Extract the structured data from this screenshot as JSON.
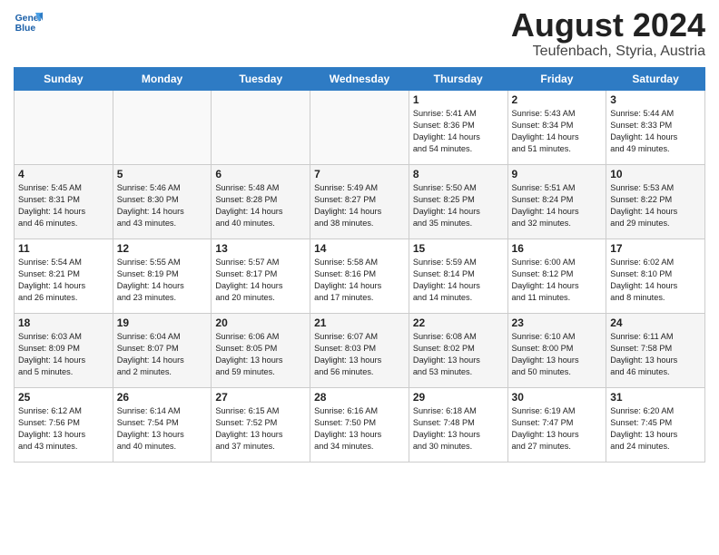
{
  "header": {
    "logo_line1": "General",
    "logo_line2": "Blue",
    "month_title": "August 2024",
    "subtitle": "Teufenbach, Styria, Austria"
  },
  "weekdays": [
    "Sunday",
    "Monday",
    "Tuesday",
    "Wednesday",
    "Thursday",
    "Friday",
    "Saturday"
  ],
  "weeks": [
    [
      {
        "day": "",
        "info": ""
      },
      {
        "day": "",
        "info": ""
      },
      {
        "day": "",
        "info": ""
      },
      {
        "day": "",
        "info": ""
      },
      {
        "day": "1",
        "info": "Sunrise: 5:41 AM\nSunset: 8:36 PM\nDaylight: 14 hours\nand 54 minutes."
      },
      {
        "day": "2",
        "info": "Sunrise: 5:43 AM\nSunset: 8:34 PM\nDaylight: 14 hours\nand 51 minutes."
      },
      {
        "day": "3",
        "info": "Sunrise: 5:44 AM\nSunset: 8:33 PM\nDaylight: 14 hours\nand 49 minutes."
      }
    ],
    [
      {
        "day": "4",
        "info": "Sunrise: 5:45 AM\nSunset: 8:31 PM\nDaylight: 14 hours\nand 46 minutes."
      },
      {
        "day": "5",
        "info": "Sunrise: 5:46 AM\nSunset: 8:30 PM\nDaylight: 14 hours\nand 43 minutes."
      },
      {
        "day": "6",
        "info": "Sunrise: 5:48 AM\nSunset: 8:28 PM\nDaylight: 14 hours\nand 40 minutes."
      },
      {
        "day": "7",
        "info": "Sunrise: 5:49 AM\nSunset: 8:27 PM\nDaylight: 14 hours\nand 38 minutes."
      },
      {
        "day": "8",
        "info": "Sunrise: 5:50 AM\nSunset: 8:25 PM\nDaylight: 14 hours\nand 35 minutes."
      },
      {
        "day": "9",
        "info": "Sunrise: 5:51 AM\nSunset: 8:24 PM\nDaylight: 14 hours\nand 32 minutes."
      },
      {
        "day": "10",
        "info": "Sunrise: 5:53 AM\nSunset: 8:22 PM\nDaylight: 14 hours\nand 29 minutes."
      }
    ],
    [
      {
        "day": "11",
        "info": "Sunrise: 5:54 AM\nSunset: 8:21 PM\nDaylight: 14 hours\nand 26 minutes."
      },
      {
        "day": "12",
        "info": "Sunrise: 5:55 AM\nSunset: 8:19 PM\nDaylight: 14 hours\nand 23 minutes."
      },
      {
        "day": "13",
        "info": "Sunrise: 5:57 AM\nSunset: 8:17 PM\nDaylight: 14 hours\nand 20 minutes."
      },
      {
        "day": "14",
        "info": "Sunrise: 5:58 AM\nSunset: 8:16 PM\nDaylight: 14 hours\nand 17 minutes."
      },
      {
        "day": "15",
        "info": "Sunrise: 5:59 AM\nSunset: 8:14 PM\nDaylight: 14 hours\nand 14 minutes."
      },
      {
        "day": "16",
        "info": "Sunrise: 6:00 AM\nSunset: 8:12 PM\nDaylight: 14 hours\nand 11 minutes."
      },
      {
        "day": "17",
        "info": "Sunrise: 6:02 AM\nSunset: 8:10 PM\nDaylight: 14 hours\nand 8 minutes."
      }
    ],
    [
      {
        "day": "18",
        "info": "Sunrise: 6:03 AM\nSunset: 8:09 PM\nDaylight: 14 hours\nand 5 minutes."
      },
      {
        "day": "19",
        "info": "Sunrise: 6:04 AM\nSunset: 8:07 PM\nDaylight: 14 hours\nand 2 minutes."
      },
      {
        "day": "20",
        "info": "Sunrise: 6:06 AM\nSunset: 8:05 PM\nDaylight: 13 hours\nand 59 minutes."
      },
      {
        "day": "21",
        "info": "Sunrise: 6:07 AM\nSunset: 8:03 PM\nDaylight: 13 hours\nand 56 minutes."
      },
      {
        "day": "22",
        "info": "Sunrise: 6:08 AM\nSunset: 8:02 PM\nDaylight: 13 hours\nand 53 minutes."
      },
      {
        "day": "23",
        "info": "Sunrise: 6:10 AM\nSunset: 8:00 PM\nDaylight: 13 hours\nand 50 minutes."
      },
      {
        "day": "24",
        "info": "Sunrise: 6:11 AM\nSunset: 7:58 PM\nDaylight: 13 hours\nand 46 minutes."
      }
    ],
    [
      {
        "day": "25",
        "info": "Sunrise: 6:12 AM\nSunset: 7:56 PM\nDaylight: 13 hours\nand 43 minutes."
      },
      {
        "day": "26",
        "info": "Sunrise: 6:14 AM\nSunset: 7:54 PM\nDaylight: 13 hours\nand 40 minutes."
      },
      {
        "day": "27",
        "info": "Sunrise: 6:15 AM\nSunset: 7:52 PM\nDaylight: 13 hours\nand 37 minutes."
      },
      {
        "day": "28",
        "info": "Sunrise: 6:16 AM\nSunset: 7:50 PM\nDaylight: 13 hours\nand 34 minutes."
      },
      {
        "day": "29",
        "info": "Sunrise: 6:18 AM\nSunset: 7:48 PM\nDaylight: 13 hours\nand 30 minutes."
      },
      {
        "day": "30",
        "info": "Sunrise: 6:19 AM\nSunset: 7:47 PM\nDaylight: 13 hours\nand 27 minutes."
      },
      {
        "day": "31",
        "info": "Sunrise: 6:20 AM\nSunset: 7:45 PM\nDaylight: 13 hours\nand 24 minutes."
      }
    ]
  ]
}
